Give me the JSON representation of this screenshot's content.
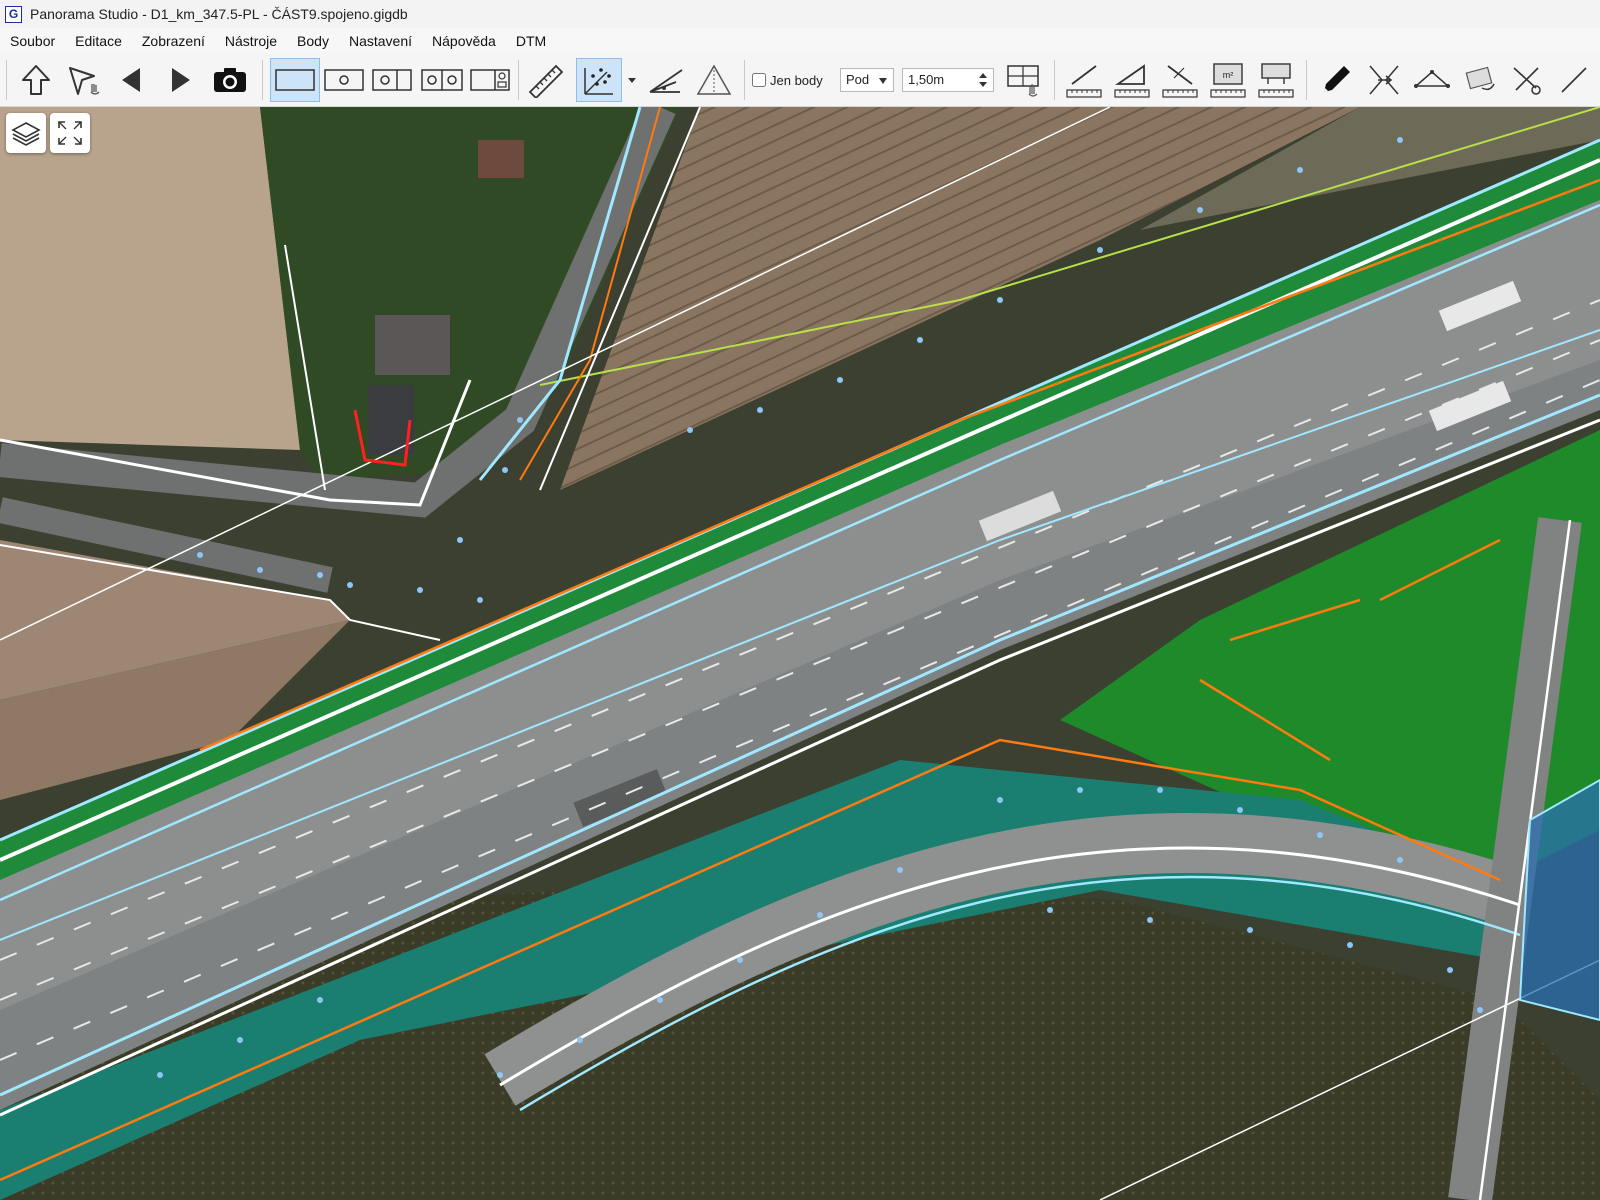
{
  "window": {
    "app_icon": "G",
    "title": "Panorama Studio - D1_km_347.5-PL - ČÁST9.spojeno.gigdb"
  },
  "menu": [
    "Soubor",
    "Editace",
    "Zobrazení",
    "Nástroje",
    "Body",
    "Nastavení",
    "Nápověda",
    "DTM"
  ],
  "toolbar": {
    "jen_body_label": "Jen body",
    "jen_body_checked": false,
    "mode_select_value": "Pod",
    "distance_value": "1,50m",
    "area_unit_label": "m²"
  },
  "map": {
    "controls": [
      "layers-icon",
      "fullscreen-icon"
    ]
  },
  "colors": {
    "accent": "#cde3f7",
    "vertex": "#8fc6f5",
    "orange_line": "#ff7a10",
    "cyan_line": "#9fe8ff"
  }
}
